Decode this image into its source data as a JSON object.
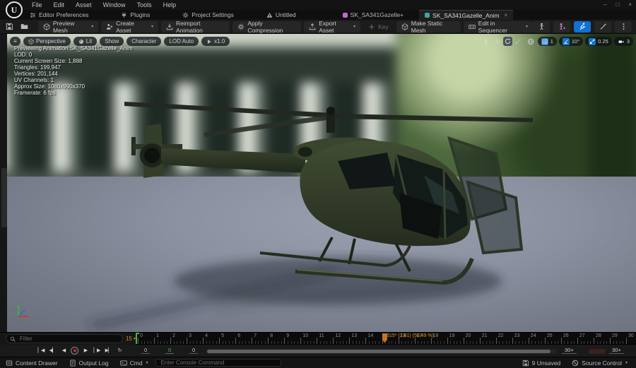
{
  "menu_bar": {
    "items": [
      {
        "label": "File"
      },
      {
        "label": "Edit"
      },
      {
        "label": "Asset"
      },
      {
        "label": "Window"
      },
      {
        "label": "Tools"
      },
      {
        "label": "Help"
      }
    ]
  },
  "window_controls": [
    {
      "name": "minimize-button",
      "glyph": "–"
    },
    {
      "name": "maximize-button",
      "glyph": "□"
    },
    {
      "name": "close-button",
      "glyph": "×"
    }
  ],
  "quick_bar": {
    "buttons": [
      {
        "name": "editor-preferences-button",
        "label": "Editor Preferences",
        "icon": "s-sliders"
      },
      {
        "name": "plugins-button",
        "label": "Plugins",
        "icon": "s-plug"
      },
      {
        "name": "project-settings-button",
        "label": "Project Settings",
        "icon": "s-gear"
      },
      {
        "name": "untitled-level-button",
        "label": "Untitled",
        "icon": "s-warning",
        "warn": true
      }
    ],
    "tabs": [
      {
        "name": "tab-sk-sa341gazelle",
        "label": "SK_SA341Gazelle+",
        "dot": "#c06ad0"
      },
      {
        "name": "tab-sk-sa341gazelle-anim",
        "label": "SK_SA341Gazelle_Anim",
        "dot": "#3fa7a0",
        "active": true,
        "close_glyph": "×"
      }
    ]
  },
  "toolbar": {
    "file_buttons": [
      {
        "name": "save-button",
        "icon": "s-floppy"
      },
      {
        "name": "browse-to-asset-button",
        "icon": "s-folder"
      }
    ],
    "buttons": [
      {
        "name": "preview-mesh-button",
        "label": "Preview Mesh",
        "icon": "s-cube",
        "dropdown": true
      },
      {
        "name": "create-asset-button",
        "label": "Create Asset",
        "icon": "s-personplus",
        "dropdown": true
      },
      {
        "name": "reimport-animation-button",
        "label": "Reimport Animation",
        "icon": "s-import"
      },
      {
        "name": "apply-compression-button",
        "label": "Apply Compression",
        "icon": "s-gear"
      },
      {
        "name": "export-asset-button",
        "label": "Export Asset",
        "icon": "s-export",
        "dropdown": true
      },
      {
        "name": "key-button",
        "label": "Key",
        "icon": "s-plus",
        "disabled": true
      },
      {
        "name": "make-static-mesh-button",
        "label": "Make Static Mesh",
        "icon": "s-cube"
      },
      {
        "name": "edit-in-sequencer-button",
        "label": "Edit in Sequencer",
        "icon": "s-sequencer",
        "dropdown": true
      }
    ],
    "right_icons": [
      {
        "name": "skeleton-button",
        "icon": "s-skeleton"
      },
      {
        "name": "preview-skeleton-star-button",
        "icon": "s-skelstar",
        "tint": "#cf8ade"
      },
      {
        "name": "animation-mode-button",
        "icon": "s-runner",
        "active": true
      },
      {
        "name": "paint-button",
        "icon": "s-brush",
        "tint": "#d8bb8e"
      },
      {
        "name": "more-options-button",
        "icon": "s-dots"
      }
    ]
  },
  "viewport": {
    "pills": [
      {
        "name": "perspective-menu",
        "label": "Perspective",
        "icon": "s-cube"
      },
      {
        "name": "view-mode-menu",
        "label": "Lit",
        "icon": "s-sphere"
      },
      {
        "name": "show-menu",
        "label": "Show"
      },
      {
        "name": "character-menu",
        "label": "Character"
      },
      {
        "name": "lod-menu",
        "label": "LOD Auto"
      },
      {
        "name": "playback-speed-menu",
        "label": "x1.0",
        "icon": "s-play"
      }
    ],
    "transform_tools": [
      {
        "name": "select-tool",
        "icon": "s-select"
      },
      {
        "name": "move-tool",
        "icon": "s-move"
      },
      {
        "name": "rotate-tool",
        "icon": "s-rotate",
        "active": true
      },
      {
        "name": "scale-tool",
        "icon": "s-scaletool"
      }
    ],
    "snaps": [
      {
        "name": "grid-snap",
        "icon": "s-grid",
        "value": "1",
        "blue": true
      },
      {
        "name": "rotation-snap",
        "icon": "s-angle",
        "value": "10°",
        "blue": true
      },
      {
        "name": "scale-snap",
        "icon": "s-scalesnap",
        "value": "0.25",
        "blue": true
      },
      {
        "name": "camera-speed",
        "icon": "s-camera",
        "value": "3"
      }
    ],
    "stats_lines": [
      "Previewing Animation SK_SA341Gazelle_Anim",
      "LOD: 0",
      "Current Screen Size: 1,888",
      "Triangles: 199,947",
      "Vertices: 201,144",
      "UV Channels: 1",
      "Approx Size: 1080x990x370",
      "Framerate: 6 fps"
    ]
  },
  "timeline": {
    "filter_placeholder": "Filter",
    "current_frame_badge": "15",
    "ruler": {
      "frames": [
        0,
        1,
        2,
        3,
        4,
        5,
        6,
        7,
        8,
        9,
        10,
        11,
        12,
        13,
        14,
        15,
        16,
        17,
        18,
        19,
        20,
        21,
        22,
        23,
        24,
        25,
        26,
        27,
        28,
        29,
        30
      ]
    },
    "playhead": {
      "frame": 15.15,
      "label": "15* (2,61) (50,49 %)"
    },
    "playback": [
      {
        "name": "go-to-front-button",
        "glyph": "▏◀"
      },
      {
        "name": "step-backward-button",
        "glyph": "◀▏"
      },
      {
        "name": "play-backward-button",
        "glyph": "◀"
      },
      {
        "name": "record-button",
        "glyph": "●",
        "record": true
      },
      {
        "name": "play-forward-button",
        "glyph": "▶"
      },
      {
        "name": "step-forward-button",
        "glyph": "▏▶"
      },
      {
        "name": "go-to-end-button",
        "glyph": "▶▏"
      },
      {
        "name": "toggle-looping-button",
        "glyph": "↻"
      }
    ],
    "fields": {
      "frame": "0",
      "time": "0",
      "percent": "0",
      "range_end_a": "30+",
      "range_end_b": "30+"
    }
  },
  "status_bar": {
    "left_items": [
      {
        "name": "content-drawer-button",
        "label": "Content Drawer",
        "icon": "s-drawer"
      },
      {
        "name": "output-log-button",
        "label": "Output Log",
        "icon": "s-log"
      },
      {
        "name": "cmd-button",
        "label": "Cmd",
        "icon": "s-cmd",
        "dropdown": true
      }
    ],
    "console_placeholder": "Enter Console Command",
    "right_items": [
      {
        "name": "unsaved-button",
        "label": "9 Unsaved",
        "icon": "s-floppy"
      },
      {
        "name": "source-control-button",
        "label": "Source Control",
        "icon": "s-slash",
        "dropdown": true
      }
    ]
  },
  "colors": {
    "accent_blue": "#0f72d0",
    "accent_orange": "#d98d12",
    "record_red": "#c23b35",
    "warning_yellow": "#dfa520",
    "snap_blue": "#1673c7"
  }
}
